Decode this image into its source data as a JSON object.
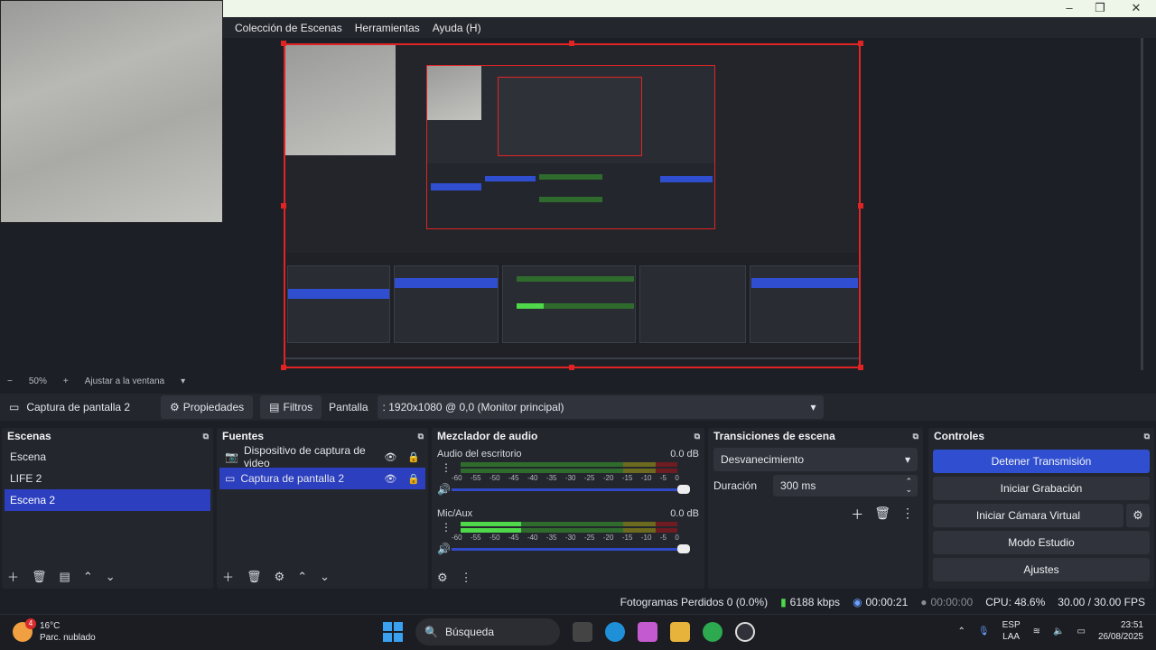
{
  "menu": [
    "Colección de Escenas",
    "Herramientas",
    "Ayuda (H)"
  ],
  "zoom": {
    "minus": "−",
    "value": "50%",
    "plus": "+",
    "fit": "Ajustar a la ventana"
  },
  "source_bar": {
    "name": "Captura de pantalla 2",
    "properties": "Propiedades",
    "filters": "Filtros",
    "display_label": "Pantalla",
    "display_value": ": 1920x1080 @ 0,0 (Monitor principal)"
  },
  "scenes": {
    "title": "Escenas",
    "items": [
      "Escena",
      "LIFE 2",
      "Escena 2"
    ],
    "selected_index": 2
  },
  "sources": {
    "title": "Fuentes",
    "items": [
      {
        "label": "Dispositivo de captura de video",
        "icon": "camera-icon"
      },
      {
        "label": "Captura de pantalla 2",
        "icon": "monitor-icon"
      }
    ],
    "selected_index": 1
  },
  "mixer": {
    "title": "Mezclador de audio",
    "tracks": [
      {
        "name": "Audio del escritorio",
        "db": "0.0 dB",
        "level": 0
      },
      {
        "name": "Mic/Aux",
        "db": "0.0 dB",
        "level": 0.3
      }
    ],
    "ticks": [
      "-60",
      "-55",
      "-50",
      "-45",
      "-40",
      "-35",
      "-30",
      "-25",
      "-20",
      "-15",
      "-10",
      "-5",
      "0"
    ]
  },
  "transitions": {
    "title": "Transiciones de escena",
    "selected": "Desvanecimiento",
    "duration_label": "Duración",
    "duration_value": "300 ms"
  },
  "controls": {
    "title": "Controles",
    "stop_stream": "Detener Transmisión",
    "start_recording": "Iniciar Grabación",
    "start_virtual_cam": "Iniciar Cámara Virtual",
    "studio_mode": "Modo Estudio",
    "settings": "Ajustes"
  },
  "status": {
    "dropped_frames": "Fotogramas Perdidos 0 (0.0%)",
    "bitrate": "6188 kbps",
    "stream_time": "00:00:21",
    "rec_time": "00:00:00",
    "cpu": "CPU: 48.6%",
    "fps": "30.00 / 30.00 FPS"
  },
  "taskbar": {
    "weather_temp": "16°C",
    "weather_desc": "Parc. nublado",
    "weather_badge": "4",
    "search": "Búsqueda",
    "lang": "ESP",
    "lang_sub": "LAA",
    "time": "23:51",
    "date": "26/08/2025"
  },
  "colors": {
    "accent": "#2f4fd0",
    "selection": "#2b3fbf",
    "recording_border": "#e02424",
    "meter_green": "#4ed84a"
  }
}
